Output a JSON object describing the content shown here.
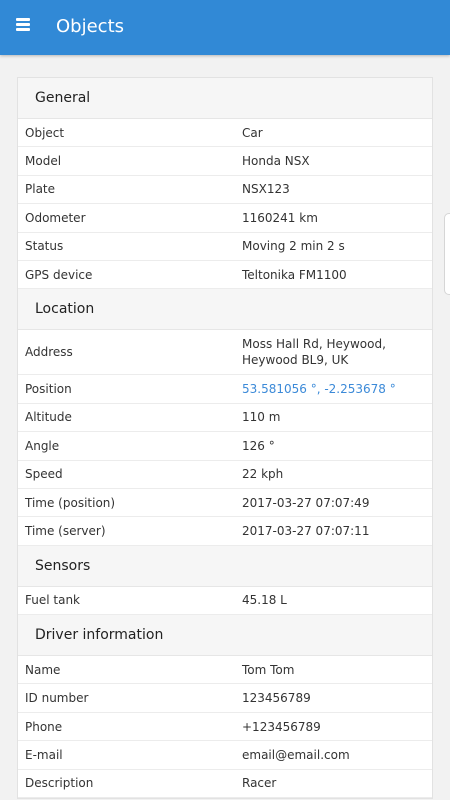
{
  "header": {
    "title": "Objects",
    "menu_icon": "hamburger-menu-icon"
  },
  "sections": {
    "general": {
      "title": "General",
      "rows": [
        {
          "label": "Object",
          "value": "Car"
        },
        {
          "label": "Model",
          "value": "Honda NSX"
        },
        {
          "label": "Plate",
          "value": "NSX123"
        },
        {
          "label": "Odometer",
          "value": "1160241 km"
        },
        {
          "label": "Status",
          "value": "Moving 2 min 2 s"
        },
        {
          "label": "GPS device",
          "value": "Teltonika FM1100"
        }
      ]
    },
    "location": {
      "title": "Location",
      "rows": [
        {
          "label": "Address",
          "value": "Moss Hall Rd, Heywood, Heywood BL9, UK"
        },
        {
          "label": "Position",
          "value": "53.581056 °, -2.253678 °"
        },
        {
          "label": "Altitude",
          "value": "110 m"
        },
        {
          "label": "Angle",
          "value": "126 °"
        },
        {
          "label": "Speed",
          "value": "22 kph"
        },
        {
          "label": "Time (position)",
          "value": "2017-03-27 07:07:49"
        },
        {
          "label": "Time (server)",
          "value": "2017-03-27 07:07:11"
        }
      ]
    },
    "sensors": {
      "title": "Sensors",
      "rows": [
        {
          "label": "Fuel tank",
          "value": "45.18 L"
        }
      ]
    },
    "driver": {
      "title": "Driver information",
      "rows": [
        {
          "label": "Name",
          "value": "Tom Tom"
        },
        {
          "label": "ID number",
          "value": "123456789"
        },
        {
          "label": "Phone",
          "value": "+123456789"
        },
        {
          "label": "E-mail",
          "value": "email@email.com"
        },
        {
          "label": "Description",
          "value": "Racer"
        }
      ]
    }
  },
  "colors": {
    "appbar": "#3189d6",
    "link": "#3c8ad8"
  }
}
